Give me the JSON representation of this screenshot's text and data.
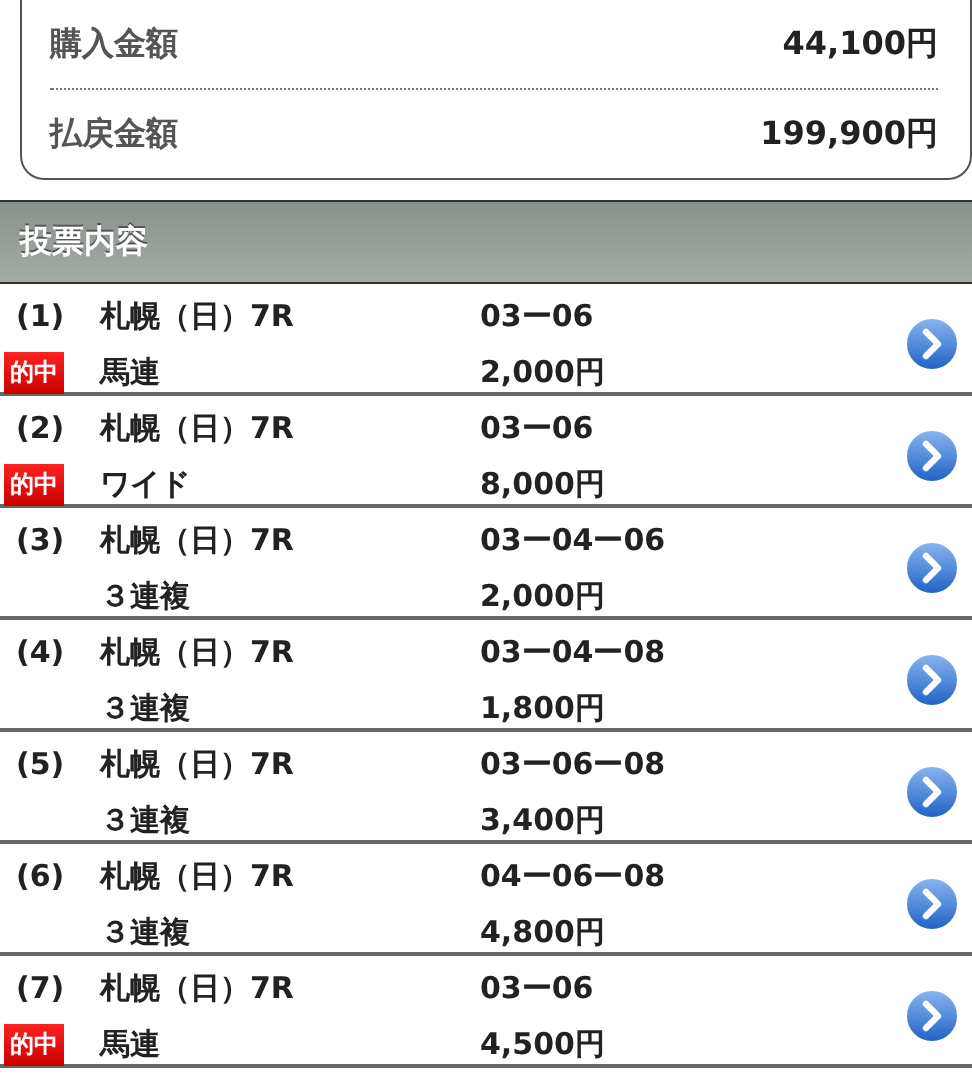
{
  "summary": [
    {
      "label": "購入金額",
      "value": "44,100円"
    },
    {
      "label": "払戻金額",
      "value": "199,900円"
    }
  ],
  "section": {
    "title": "投票内容"
  },
  "bets": [
    {
      "number": "(1)",
      "race": "札幌（日）7R",
      "badge": "的中",
      "type": "馬連",
      "combination": "03ー06",
      "amount": "2,000円"
    },
    {
      "number": "(2)",
      "race": "札幌（日）7R",
      "badge": "的中",
      "type": "ワイド",
      "combination": "03ー06",
      "amount": "8,000円"
    },
    {
      "number": "(3)",
      "race": "札幌（日）7R",
      "type": "３連複",
      "combination": "03ー04ー06",
      "amount": "2,000円"
    },
    {
      "number": "(4)",
      "race": "札幌（日）7R",
      "type": "３連複",
      "combination": "03ー04ー08",
      "amount": "1,800円"
    },
    {
      "number": "(5)",
      "race": "札幌（日）7R",
      "type": "３連複",
      "combination": "03ー06ー08",
      "amount": "3,400円"
    },
    {
      "number": "(6)",
      "race": "札幌（日）7R",
      "type": "３連複",
      "combination": "04ー06ー08",
      "amount": "4,800円"
    },
    {
      "number": "(7)",
      "race": "札幌（日）7R",
      "badge": "的中",
      "type": "馬連",
      "combination": "03ー06",
      "amount": "4,500円"
    }
  ]
}
